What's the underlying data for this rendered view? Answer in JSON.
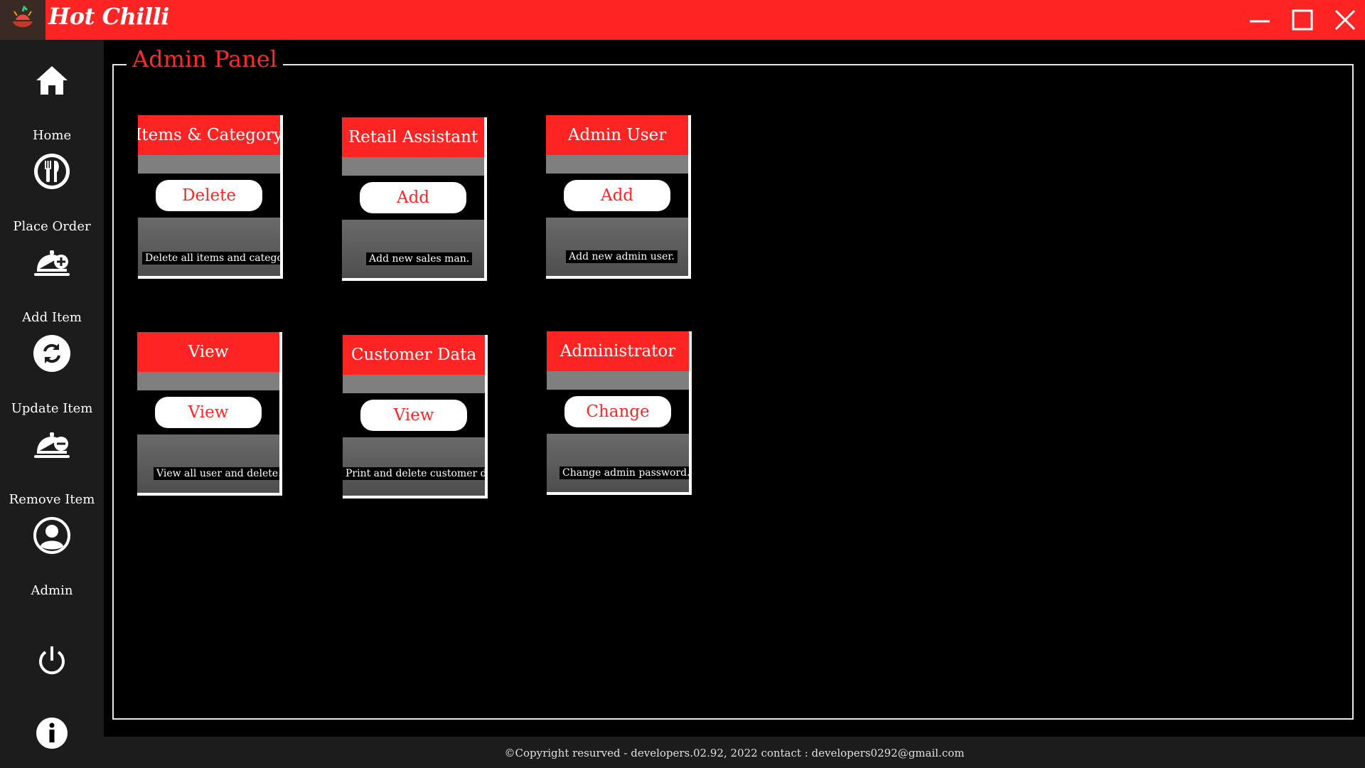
{
  "app": {
    "title": "Hot Chilli"
  },
  "sidebar": {
    "items": [
      {
        "label": "Home",
        "icon": "home-icon"
      },
      {
        "label": "Place Order",
        "icon": "fork-knife-icon"
      },
      {
        "label": "Add Item",
        "icon": "cloche-add-icon"
      },
      {
        "label": "Update Item",
        "icon": "refresh-icon"
      },
      {
        "label": "Remove Item",
        "icon": "cloche-remove-icon"
      },
      {
        "label": "Admin",
        "icon": "user-icon"
      }
    ]
  },
  "panel": {
    "title": "Admin Panel"
  },
  "cards": [
    {
      "title": "Items & Category",
      "button": "Delete",
      "description": "Delete all items and catego"
    },
    {
      "title": "Retail Assistant",
      "button": "Add",
      "description": "Add new sales man."
    },
    {
      "title": "Admin User",
      "button": "Add",
      "description": "Add new admin user."
    },
    {
      "title": "View",
      "button": "View",
      "description": "View all user and delete."
    },
    {
      "title": "Customer Data",
      "button": "View",
      "description": "Print and delete customer da"
    },
    {
      "title": "Administrator",
      "button": "Change",
      "description": "Change admin password."
    }
  ],
  "footer": {
    "text": "©Copyright resurved - developers.02.92, 2022  contact : developers0292@gmail.com"
  },
  "colors": {
    "accent": "#ff2424",
    "sidebar": "#1c1c1c",
    "background": "#000000"
  }
}
